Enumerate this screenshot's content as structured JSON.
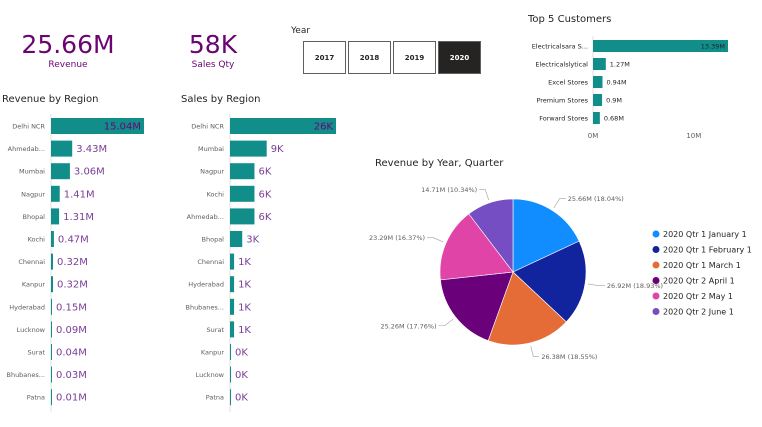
{
  "colors": {
    "accent": "#118d8a",
    "kpi": "#6a0572",
    "label": "#7a3e98",
    "axis": "#666666"
  },
  "kpis": [
    {
      "value": "25.66M",
      "label": "Revenue"
    },
    {
      "value": "58K",
      "label": "Sales Qty"
    }
  ],
  "year_slicer": {
    "title": "Year",
    "options": [
      "2017",
      "2018",
      "2019",
      "2020"
    ],
    "selected": "2020"
  },
  "chart_data": [
    {
      "id": "revenue-by-region",
      "type": "bar",
      "orientation": "horizontal",
      "title": "Revenue by Region",
      "categories": [
        "Delhi NCR",
        "Ahmedab...",
        "Mumbai",
        "Nagpur",
        "Bhopal",
        "Kochi",
        "Chennai",
        "Kanpur",
        "Hyderabad",
        "Lucknow",
        "Surat",
        "Bhubanes...",
        "Patna"
      ],
      "values": [
        15.04,
        3.43,
        3.06,
        1.41,
        1.31,
        0.47,
        0.32,
        0.32,
        0.15,
        0.09,
        0.04,
        0.03,
        0.01
      ],
      "labels": [
        "15.04M",
        "3.43M",
        "3.06M",
        "1.41M",
        "1.31M",
        "0.47M",
        "0.32M",
        "0.32M",
        "0.15M",
        "0.09M",
        "0.04M",
        "0.03M",
        "0.01M"
      ],
      "unit": "M"
    },
    {
      "id": "sales-by-region",
      "type": "bar",
      "orientation": "horizontal",
      "title": "Sales by Region",
      "categories": [
        "Delhi NCR",
        "Mumbai",
        "Nagpur",
        "Kochi",
        "Ahmedab...",
        "Bhopal",
        "Chennai",
        "Hyderabad",
        "Bhubanes...",
        "Surat",
        "Kanpur",
        "Lucknow",
        "Patna"
      ],
      "values": [
        26,
        9,
        6,
        6,
        6,
        3,
        1,
        1,
        1,
        1,
        0,
        0,
        0
      ],
      "labels": [
        "26K",
        "9K",
        "6K",
        "6K",
        "6K",
        "3K",
        "1K",
        "1K",
        "1K",
        "1K",
        "0K",
        "0K",
        "0K"
      ],
      "unit": "K"
    },
    {
      "id": "top-5-customers",
      "type": "bar",
      "orientation": "horizontal",
      "title": "Top 5 Customers",
      "categories": [
        "Electricalsara S...",
        "Electricalslytical",
        "Excel Stores",
        "Premium Stores",
        "Forward Stores"
      ],
      "values": [
        13.39,
        1.27,
        0.94,
        0.9,
        0.68
      ],
      "labels": [
        "13.39M",
        "1.27M",
        "0.94M",
        "0.9M",
        "0.68M"
      ],
      "xlim": [
        0,
        13.39
      ],
      "xticks": [
        {
          "value": 0,
          "label": "0M"
        },
        {
          "value": 10,
          "label": "10M"
        }
      ],
      "unit": "M"
    },
    {
      "id": "revenue-by-year-quarter",
      "type": "pie",
      "title": "Revenue by Year, Quarter",
      "legend_position": "right",
      "slices": [
        {
          "name": "2020 Qtr 1 January 1",
          "value": 25.66,
          "label": "25.66M (18.04%)",
          "color": "#118dff"
        },
        {
          "name": "2020 Qtr 1 February 1",
          "value": 26.92,
          "label": "26.92M (18.93%)",
          "color": "#12239e"
        },
        {
          "name": "2020 Qtr 1 March 1",
          "value": 26.38,
          "label": "26.38M (18.55%)",
          "color": "#e66c37"
        },
        {
          "name": "2020 Qtr 2 April 1",
          "value": 25.26,
          "label": "25.26M (17.76%)",
          "color": "#6b007b"
        },
        {
          "name": "2020 Qtr 2 May 1",
          "value": 23.29,
          "label": "23.29M (16.37%)",
          "color": "#e044a7"
        },
        {
          "name": "2020 Qtr 2 June 1",
          "value": 14.71,
          "label": "14.71M (10.34%)",
          "color": "#744ec2"
        }
      ]
    }
  ]
}
